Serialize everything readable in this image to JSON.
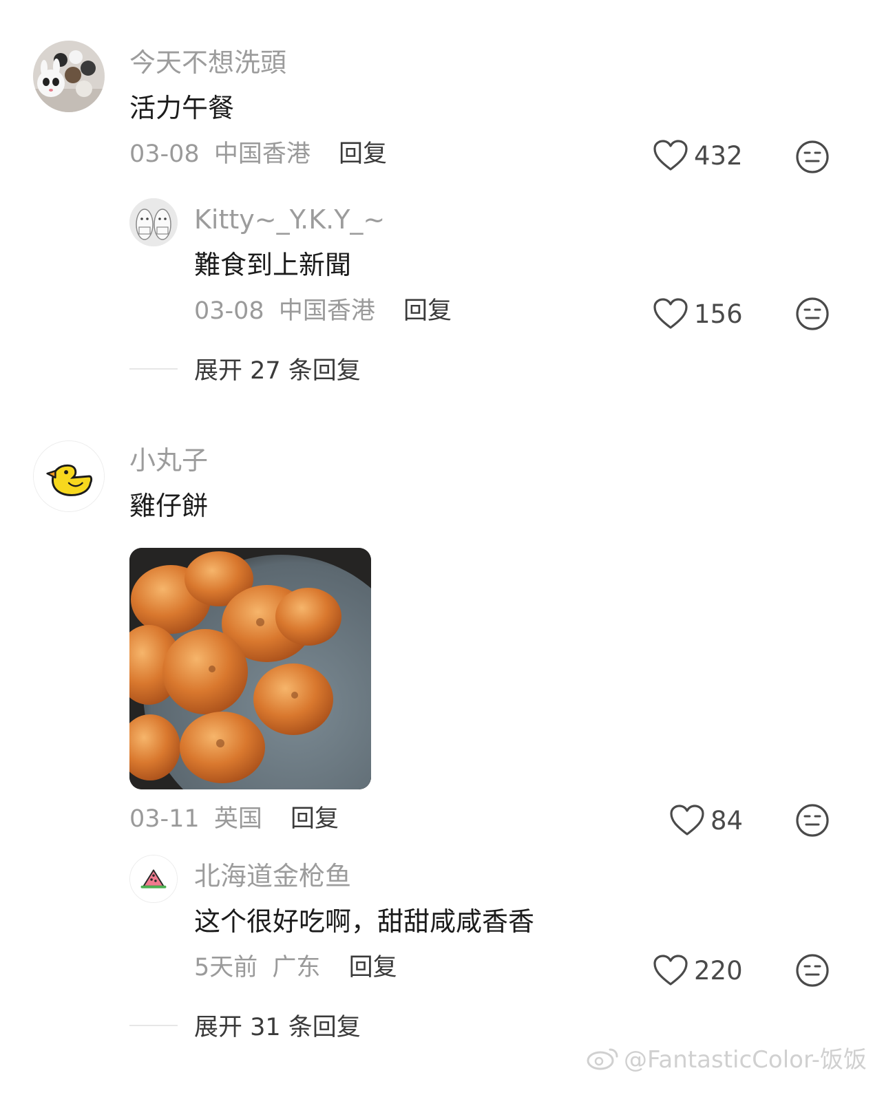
{
  "comments": [
    {
      "username": "今天不想洗頭",
      "text": "活力午餐",
      "date": "03-08",
      "location": "中国香港",
      "reply_label": "回复",
      "likes": "432",
      "reply": {
        "username": "Kitty~_Y.K.Y_~",
        "text": "難食到上新聞",
        "date": "03-08",
        "location": "中国香港",
        "reply_label": "回复",
        "likes": "156"
      },
      "expand_label": "展开 27 条回复"
    },
    {
      "username": "小丸子",
      "text": "雞仔餅",
      "date": "03-11",
      "location": "英国",
      "reply_label": "回复",
      "likes": "84",
      "reply": {
        "username": "北海道金枪鱼",
        "text": "这个很好吃啊，甜甜咸咸香香",
        "date": "5天前",
        "location": "广东",
        "reply_label": "回复",
        "likes": "220"
      },
      "expand_label": "展开 31 条回复"
    }
  ],
  "watermark": "@FantasticColor-饭饭",
  "colors": {
    "username": "#9c9c9c",
    "text": "#1b1b1b",
    "meta": "#9a9a9a",
    "icon": "#4a4a4a"
  }
}
